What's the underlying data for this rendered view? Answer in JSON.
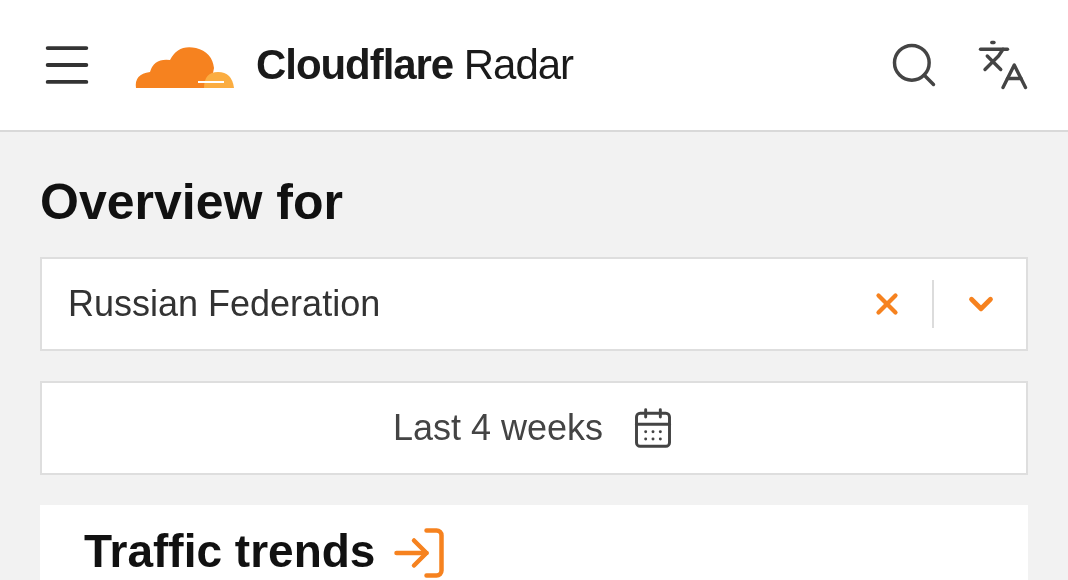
{
  "header": {
    "brand": "Cloudflare",
    "product": "Radar"
  },
  "heading": "Overview for",
  "location_select": {
    "value": "Russian Federation"
  },
  "date_range": {
    "label": "Last 4 weeks"
  },
  "card": {
    "title": "Traffic trends"
  }
}
